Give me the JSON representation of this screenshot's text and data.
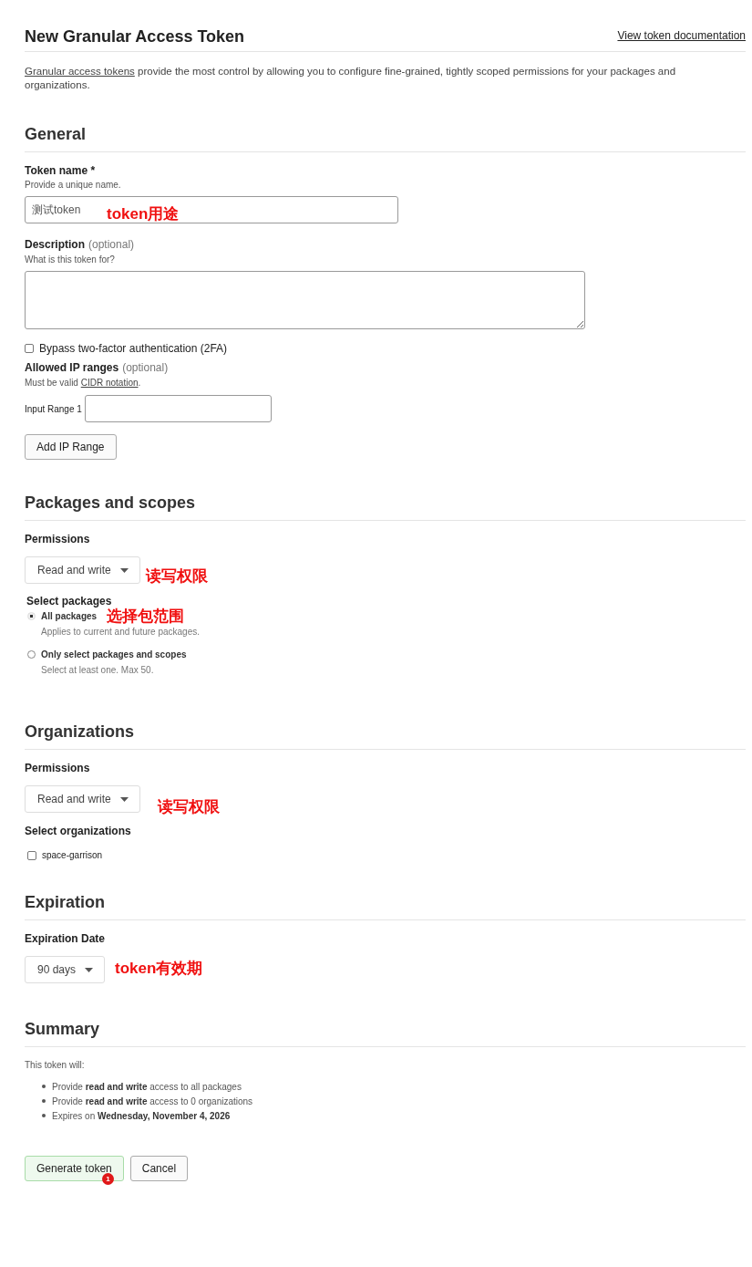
{
  "header": {
    "title": "New Granular Access Token",
    "doc_link": "View token documentation"
  },
  "intro": {
    "link": "Granular access tokens",
    "text": " provide the most control by allowing you to configure fine-grained, tightly scoped permissions for your packages and organizations."
  },
  "general": {
    "heading": "General",
    "token_name": {
      "label": "Token name *",
      "hint": "Provide a unique name.",
      "value": "测试token",
      "annotation": "token用途"
    },
    "description": {
      "label": "Description",
      "optional": "(optional)",
      "hint": "What is this token for?"
    },
    "bypass_2fa": {
      "label": "Bypass two-factor authentication (2FA)",
      "checked": false
    },
    "ip_ranges": {
      "label": "Allowed IP ranges",
      "optional": "(optional)",
      "hint_before": "Must be valid ",
      "hint_link": "CIDR notation",
      "hint_after": ".",
      "inputs": [
        {
          "label": "Input Range 1"
        }
      ],
      "add_button": "Add IP Range"
    }
  },
  "packages": {
    "heading": "Packages and scopes",
    "permissions_label": "Permissions",
    "permissions_value": "Read and write",
    "annotation": "读写权限",
    "select_label": "Select packages",
    "select_annotation": "选择包范围",
    "options": [
      {
        "label": "All packages",
        "hint": "Applies to current and future packages.",
        "selected": true
      },
      {
        "label": "Only select packages and scopes",
        "hint": "Select at least one. Max 50.",
        "selected": false
      }
    ]
  },
  "organizations": {
    "heading": "Organizations",
    "permissions_label": "Permissions",
    "permissions_value": "Read and write",
    "annotation": "读写权限",
    "select_label": "Select organizations",
    "items": [
      {
        "label": "space-garrison",
        "checked": false
      }
    ]
  },
  "expiration": {
    "heading": "Expiration",
    "label": "Expiration Date",
    "value": "90 days",
    "annotation": "token有效期"
  },
  "summary": {
    "heading": "Summary",
    "intro": "This token will:",
    "items": [
      "Provide **read and write** access to all packages",
      "Provide **read and write** access to 0 organizations",
      "Expires on **Wednesday, November 4, 2026**"
    ]
  },
  "buttons": {
    "generate": "Generate token",
    "generate_badge": "1",
    "cancel": "Cancel"
  }
}
